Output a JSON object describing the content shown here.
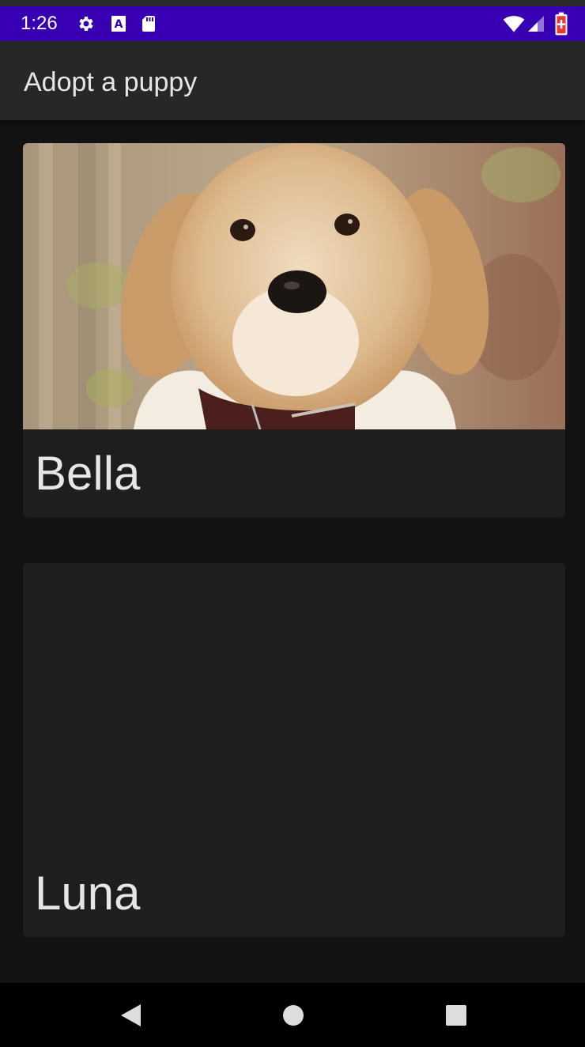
{
  "status_bar": {
    "time": "1:26",
    "icons": [
      "gear-icon",
      "font-a-icon",
      "sd-card-icon",
      "wifi-icon",
      "signal-icon",
      "battery-charging-icon"
    ]
  },
  "app_bar": {
    "title": "Adopt a puppy"
  },
  "puppies": [
    {
      "name": "Bella",
      "image": "golden-retriever-puppy-photo"
    },
    {
      "name": "Luna"
    }
  ],
  "nav_bar": {
    "buttons": [
      "back-icon",
      "home-icon",
      "recents-icon"
    ]
  },
  "colors": {
    "status_bar": "#3700b3",
    "app_bar": "#272727",
    "background": "#121212",
    "card": "#1e1e1e",
    "text": "#e6e6e6"
  }
}
